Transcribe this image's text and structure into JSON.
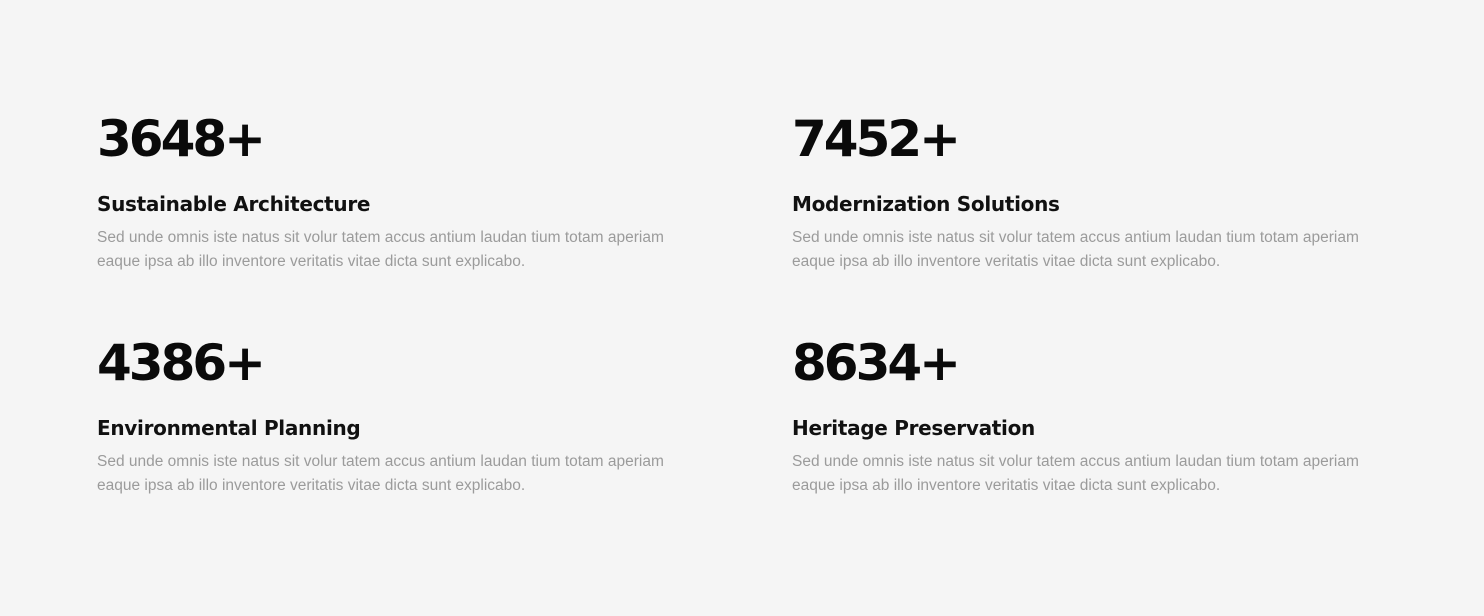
{
  "stats": [
    {
      "number": "3648+",
      "title": "Sustainable Architecture",
      "description": "Sed unde omnis iste natus sit volur tatem accus antium laudan tium totam aperiam eaque ipsa ab illo inventore veritatis vitae dicta sunt explicabo."
    },
    {
      "number": "7452+",
      "title": "Modernization Solutions",
      "description": "Sed unde omnis iste natus sit volur tatem accus antium laudan tium totam aperiam eaque ipsa ab illo inventore veritatis vitae dicta sunt explicabo."
    },
    {
      "number": "4386+",
      "title": "Environmental Planning",
      "description": "Sed unde omnis iste natus sit volur tatem accus antium laudan tium totam aperiam eaque ipsa ab illo inventore veritatis vitae dicta sunt explicabo."
    },
    {
      "number": "8634+",
      "title": "Heritage Preservation",
      "description": "Sed unde omnis iste natus sit volur tatem accus antium laudan tium totam aperiam eaque ipsa ab illo inventore veritatis vitae dicta sunt explicabo."
    }
  ],
  "colors": {
    "background": "#f5f5f5",
    "number": "#0a0a0a",
    "title": "#111111",
    "description": "#9b9b9b"
  }
}
